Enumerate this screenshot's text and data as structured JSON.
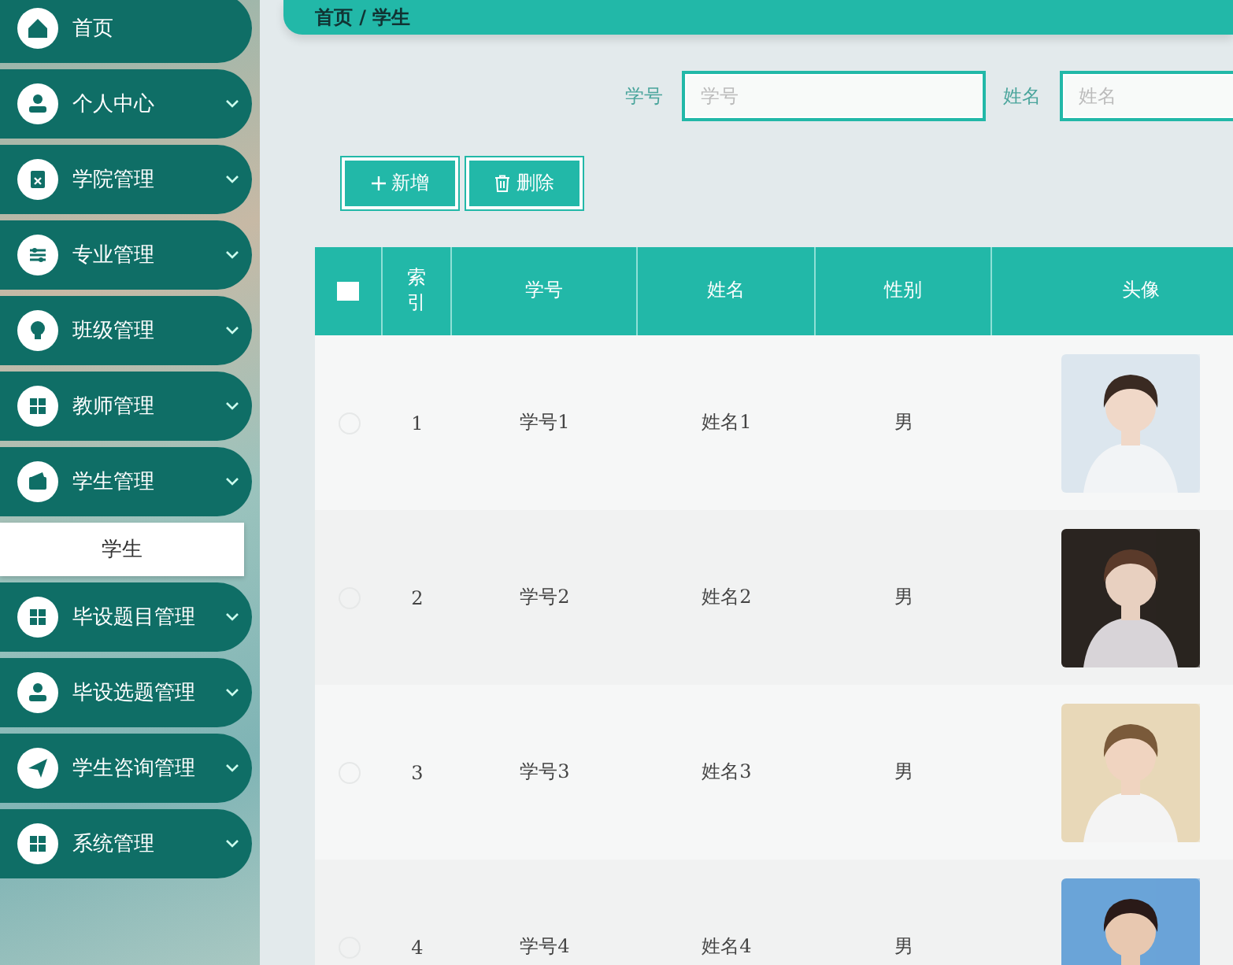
{
  "sidebar": {
    "items": [
      {
        "label": "首页",
        "kind": "link"
      },
      {
        "label": "个人中心",
        "kind": "menu"
      },
      {
        "label": "学院管理",
        "kind": "menu"
      },
      {
        "label": "专业管理",
        "kind": "menu"
      },
      {
        "label": "班级管理",
        "kind": "menu"
      },
      {
        "label": "教师管理",
        "kind": "menu"
      },
      {
        "label": "学生管理",
        "kind": "menu",
        "children": [
          {
            "label": "学生"
          }
        ]
      },
      {
        "label": "毕设题目管理",
        "kind": "menu"
      },
      {
        "label": "毕设选题管理",
        "kind": "menu"
      },
      {
        "label": "学生咨询管理",
        "kind": "menu"
      },
      {
        "label": "系统管理",
        "kind": "menu"
      }
    ]
  },
  "breadcrumb": {
    "text": "首页 / 学生"
  },
  "search": {
    "fields": [
      {
        "label": "学号",
        "placeholder": "学号"
      },
      {
        "label": "姓名",
        "placeholder": "姓名"
      }
    ]
  },
  "actions": [
    {
      "label": "新增",
      "kind": "add"
    },
    {
      "label": "删除",
      "kind": "delete"
    }
  ],
  "table": {
    "select_all": {
      "checked": false
    },
    "columns": [
      "索引",
      "学号",
      "姓名",
      "性别",
      "头像"
    ],
    "rows": [
      {
        "index": "1",
        "student_no": "学号1",
        "name": "姓名1",
        "gender": "男",
        "checked": false
      },
      {
        "index": "2",
        "student_no": "学号2",
        "name": "姓名2",
        "gender": "男",
        "checked": false
      },
      {
        "index": "3",
        "student_no": "学号3",
        "name": "姓名3",
        "gender": "男",
        "checked": false
      },
      {
        "index": "4",
        "student_no": "学号4",
        "name": "姓名4",
        "gender": "男",
        "checked": false
      }
    ]
  }
}
